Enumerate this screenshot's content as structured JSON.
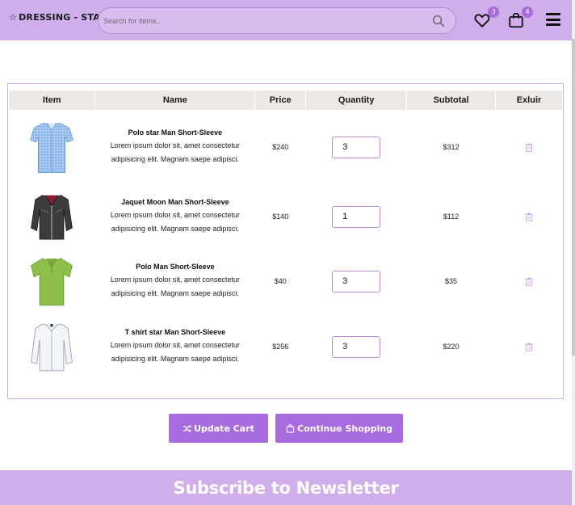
{
  "header": {
    "brand": "DRESSING - STAR",
    "search_placeholder": "Search for items..",
    "wishlist_count": "3",
    "cart_count": "4"
  },
  "table": {
    "headers": [
      "Item",
      "Name",
      "Price",
      "Quantity",
      "Subtotal",
      "Exluir"
    ],
    "rows": [
      {
        "name": "Polo star Man Short-Sleeve",
        "desc": "Lorem ipsum dolor sit, amet consectetur adipisicing elit. Magnam saepe adipisci.",
        "price": "$240",
        "qty": "3",
        "subtotal": "$312",
        "image": "blue-checked-shirt"
      },
      {
        "name": "Jaquet Moon Man Short-Sleeve",
        "desc": "Lorem ipsum dolor sit, amet consectetur adipisicing elit. Magnam saepe adipisci.",
        "price": "$140",
        "qty": "1",
        "subtotal": "$112",
        "image": "leather-jacket"
      },
      {
        "name": "Polo Man Short-Sleeve",
        "desc": "Lorem ipsum dolor sit, amet consectetur adipisicing elit. Magnam saepe adipisci.",
        "price": "$40",
        "qty": "3",
        "subtotal": "$35",
        "image": "green-polo-shirt"
      },
      {
        "name": "T shirt star Man Short-Sleeve",
        "desc": "Lorem ipsum dolor sit, amet consectetur adipisicing elit. Magnam saepe adipisci.",
        "price": "$256",
        "qty": "3",
        "subtotal": "$220",
        "image": "white-dress-shirt"
      }
    ]
  },
  "actions": {
    "update_label": "Update Cart",
    "continue_label": "Continue Shopping"
  },
  "newsletter": {
    "title": "Subscribe to Newsletter"
  },
  "colors": {
    "accent": "#a86be0",
    "header_bg": "#cfaeeb",
    "table_head_bg": "#ece9e6"
  }
}
